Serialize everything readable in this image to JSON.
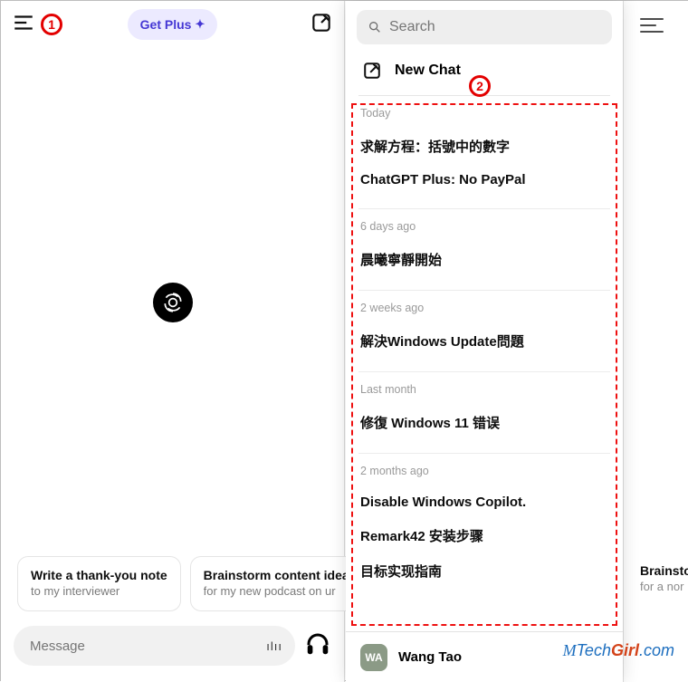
{
  "header": {
    "get_plus_label": "Get Plus"
  },
  "suggestions": [
    {
      "title": "Write a thank-you note",
      "sub": "to my interviewer"
    },
    {
      "title": "Brainstorm content ideas",
      "sub": "for my new podcast on ur"
    }
  ],
  "message_placeholder": "Message",
  "sidebar": {
    "search_placeholder": "Search",
    "new_chat_label": "New Chat",
    "groups": [
      {
        "label": "Today",
        "items": [
          "求解方程：括號中的數字",
          "ChatGPT Plus: No PayPal"
        ]
      },
      {
        "label": "6 days ago",
        "items": [
          "晨曦寧靜開始"
        ]
      },
      {
        "label": "2 weeks ago",
        "items": [
          "解決Windows Update問題"
        ]
      },
      {
        "label": "Last month",
        "items": [
          "修復 Windows 11 错误"
        ]
      },
      {
        "label": "2 months ago",
        "items": [
          "Disable Windows Copilot.",
          "Remark42 安装步骤",
          "目标实现指南"
        ]
      }
    ],
    "user": {
      "initials": "WA",
      "name": "Wang Tao"
    }
  },
  "right_suggestion": {
    "title": "Brainsto",
    "sub": "for a nor"
  },
  "annotations": {
    "badge1": "1",
    "badge2": "2"
  },
  "watermark_plain": "Tech",
  "watermark_accent": "Girl",
  "watermark_suffix": ".com"
}
